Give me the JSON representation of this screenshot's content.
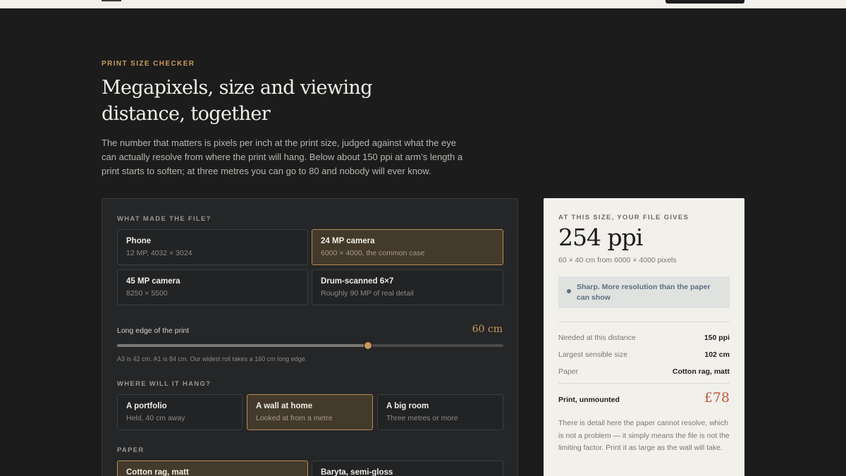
{
  "hero": {
    "eyebrow": "PRINT SIZE CHECKER",
    "title": "Megapixels, size and viewing distance, together",
    "intro": "The number that matters is pixels per inch at the print size, judged against what the eye can actually resolve from where the print will hang. Below about 150 ppi at arm’s length a print starts to soften; at three metres you can go to 80 and nobody will ever know."
  },
  "source": {
    "label": "WHAT MADE THE FILE?",
    "options": [
      {
        "title": "Phone",
        "sub": "12 MP, 4032 × 3024",
        "selected": false
      },
      {
        "title": "24 MP camera",
        "sub": "6000 × 4000, the common case",
        "selected": true
      },
      {
        "title": "45 MP camera",
        "sub": "8250 × 5500",
        "selected": false
      },
      {
        "title": "Drum-scanned 6×7",
        "sub": "Roughly 90 MP of real detail",
        "selected": false
      }
    ]
  },
  "size": {
    "label": "Long edge of the print",
    "value_text": "60 cm",
    "value_cm": 60,
    "max_cm": 160,
    "note": "A3 is 42 cm. A1 is 84 cm. Our widest roll takes a 160 cm long edge."
  },
  "hang": {
    "label": "WHERE WILL IT HANG?",
    "options": [
      {
        "title": "A portfolio",
        "sub": "Held, 40 cm away",
        "selected": false
      },
      {
        "title": "A wall at home",
        "sub": "Looked at from a metre",
        "selected": true
      },
      {
        "title": "A big room",
        "sub": "Three metres or more",
        "selected": false
      }
    ]
  },
  "paper": {
    "label": "PAPER",
    "options": [
      {
        "title": "Cotton rag, matt",
        "selected": true
      },
      {
        "title": "Baryta, semi-gloss",
        "selected": false
      }
    ]
  },
  "result": {
    "eyebrow": "AT THIS SIZE, YOUR FILE GIVES",
    "ppi": "254 ppi",
    "sub": "60 × 40 cm from 6000 × 4000 pixels",
    "verdict": "Sharp. More resolution than the paper can show",
    "rows": [
      {
        "k": "Needed at this distance",
        "v": "150 ppi"
      },
      {
        "k": "Largest sensible size",
        "v": "102 cm"
      },
      {
        "k": "Paper",
        "v": "Cotton rag, matt"
      }
    ],
    "price_label": "Print, unmounted",
    "price": "£78",
    "note": "There is detail here the paper cannot resolve, which is not a problem — it simply means the file is not the limiting factor. Print it as large as the wall will take."
  },
  "colors": {
    "accent": "#c99a5b",
    "price": "#c05a3f",
    "verdict": "#5b6f80"
  }
}
